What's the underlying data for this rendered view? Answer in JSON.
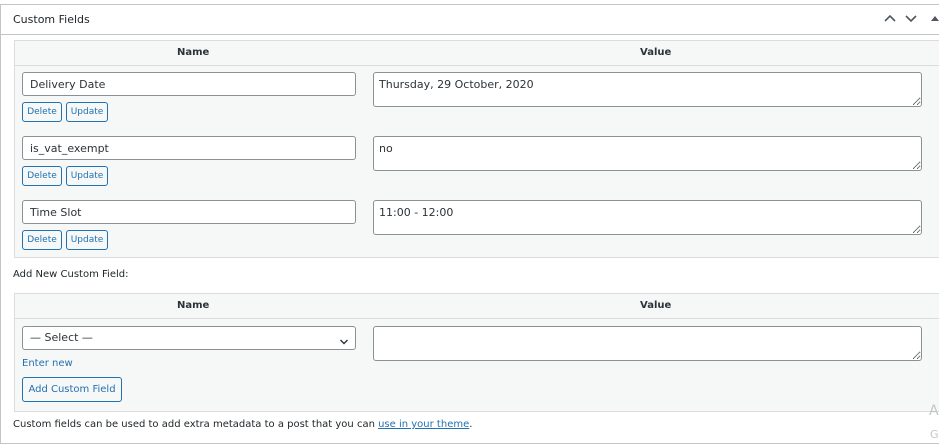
{
  "panel": {
    "title": "Custom Fields"
  },
  "existing_table": {
    "columns": {
      "name": "Name",
      "value": "Value"
    },
    "rows": [
      {
        "name": "Delivery Date",
        "value": "Thursday, 29 October, 2020",
        "delete_label": "Delete",
        "update_label": "Update"
      },
      {
        "name": "is_vat_exempt",
        "value": "no",
        "delete_label": "Delete",
        "update_label": "Update"
      },
      {
        "name": "Time Slot",
        "value": "11:00 - 12:00",
        "delete_label": "Delete",
        "update_label": "Update"
      }
    ]
  },
  "add_new": {
    "label": "Add New Custom Field:",
    "columns": {
      "name": "Name",
      "value": "Value"
    },
    "select_value": "— Select —",
    "enter_new_label": "Enter new",
    "value": "",
    "add_button_label": "Add Custom Field"
  },
  "footer": {
    "text_before": "Custom fields can be used to add extra metadata to a post that you can ",
    "link_text": "use in your theme",
    "text_after": "."
  },
  "icons": {
    "collapse_up": "chevron-up-icon",
    "collapse_down": "chevron-down-icon",
    "toggle": "triangle-up-icon"
  },
  "colors": {
    "accent": "#2271b1",
    "border": "#c3c4c7",
    "table_bg": "#f6f7f7"
  }
}
